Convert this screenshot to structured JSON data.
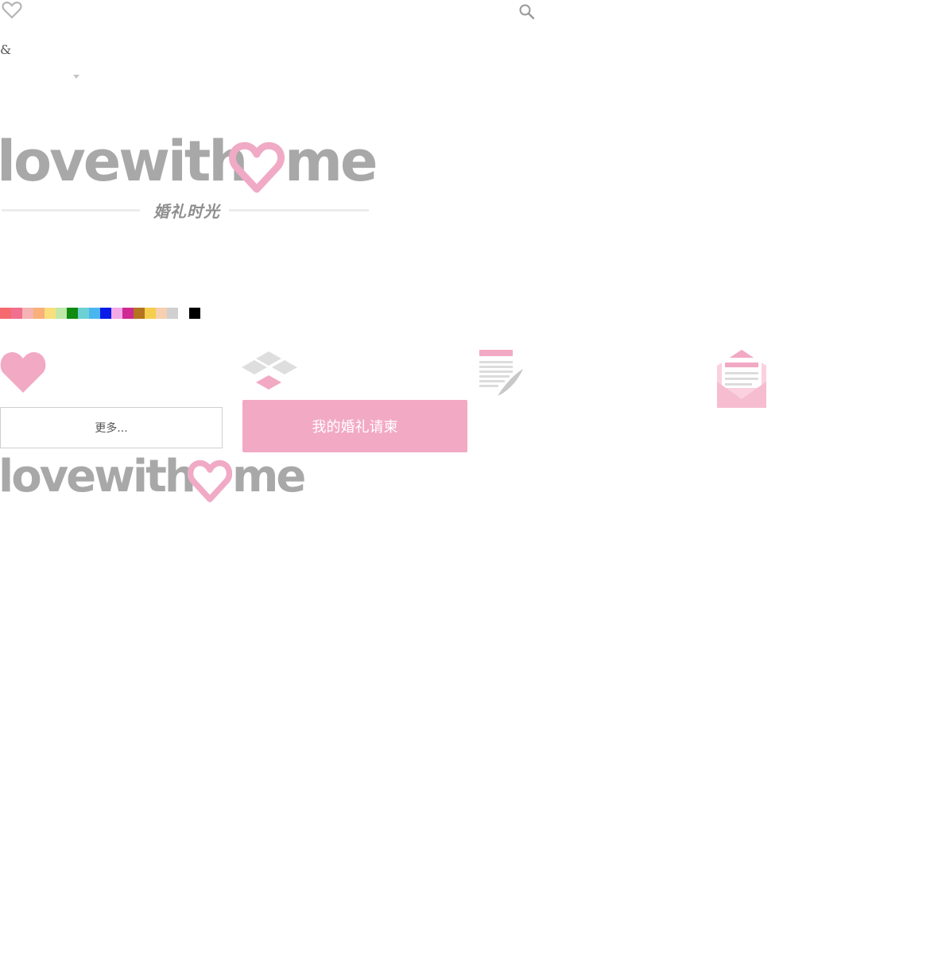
{
  "header": {
    "favorite_icon": "heart-outline-icon",
    "search_icon": "search-icon",
    "ampersand": "&"
  },
  "logo": {
    "word_before": "lovewith",
    "word_after": "me",
    "heart_icon": "heart-outline-icon",
    "tagline": "婚礼时光"
  },
  "colors": {
    "accent_pink": "#f2a9c4",
    "logo_gray": "#a8a8a8",
    "swatches": [
      "#f46a6e",
      "#f1708f",
      "#f6b3b3",
      "#f9b07a",
      "#f8df7c",
      "#bfe7a8",
      "#118a12",
      "#6cd0d4",
      "#4ab6ef",
      "#0a1ae8",
      "#f2a9e6",
      "#cf2a93",
      "#b57420",
      "#f6ce4e",
      "#f6d0b0",
      "#d0d0d0",
      "",
      "#000000"
    ]
  },
  "features": {
    "icons": [
      "heart-icon",
      "diamond-icon",
      "document-pen-icon",
      "envelope-icon"
    ]
  },
  "buttons": {
    "more_label": "更多...",
    "invite_label": "我的婚礼请柬"
  },
  "logo_small": {
    "word_before": "lovewith",
    "word_after": "me"
  }
}
